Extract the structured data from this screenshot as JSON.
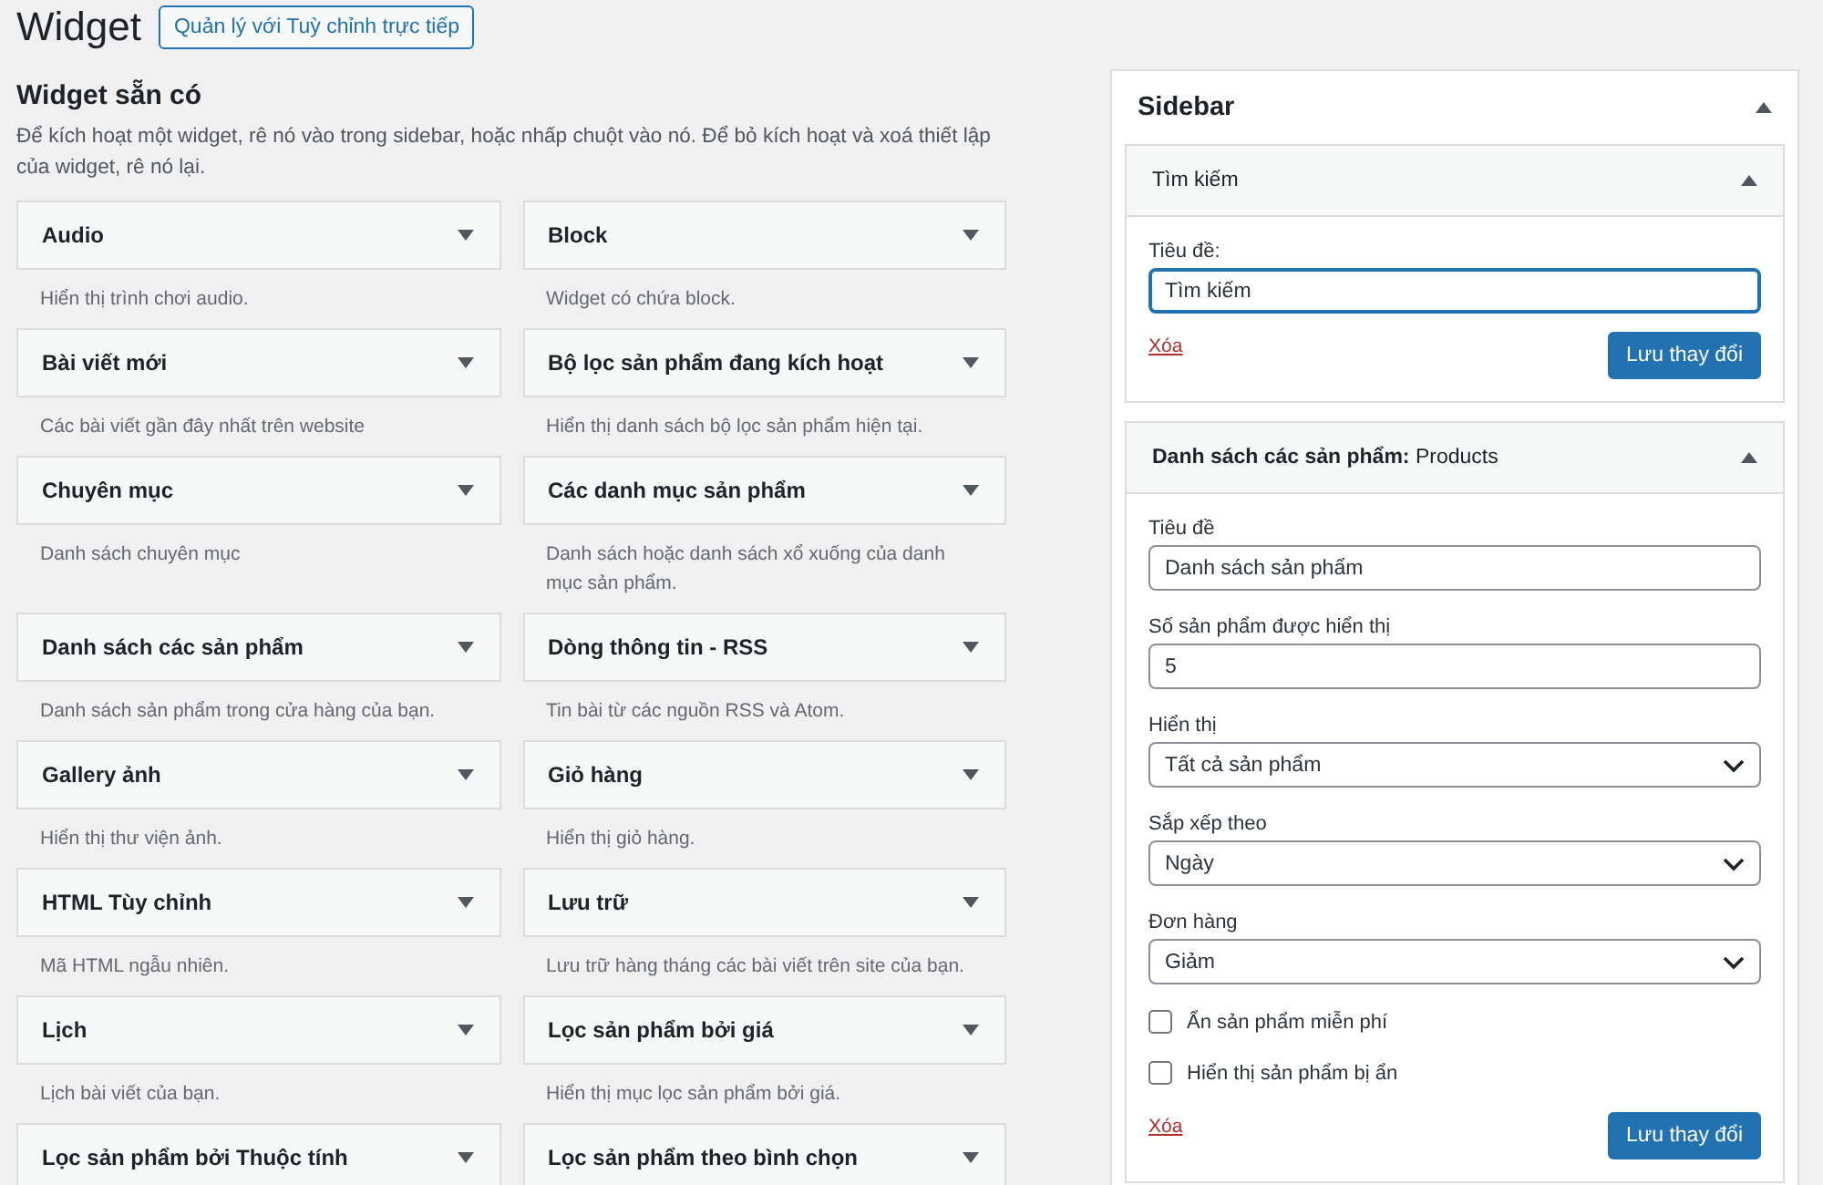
{
  "page": {
    "title": "Widget",
    "action_button": "Quản lý với Tuỳ chỉnh trực tiếp"
  },
  "available": {
    "heading": "Widget sẵn có",
    "description": "Để kích hoạt một widget, rê nó vào trong sidebar, hoặc nhấp chuột vào nó. Để bỏ kích hoạt và xoá thiết lập của widget, rê nó lại.",
    "widgets": [
      {
        "name": "Audio",
        "description": "Hiển thị trình chơi audio."
      },
      {
        "name": "Block",
        "description": "Widget có chứa block."
      },
      {
        "name": "Bài viết mới",
        "description": "Các bài viết gần đây nhất trên website"
      },
      {
        "name": "Bộ lọc sản phẩm đang kích hoạt",
        "description": "Hiển thị danh sách bộ lọc sản phẩm hiện tại."
      },
      {
        "name": "Chuyên mục",
        "description": "Danh sách chuyên mục"
      },
      {
        "name": "Các danh mục sản phẩm",
        "description": "Danh sách hoặc danh sách xổ xuống của danh mục sản phẩm."
      },
      {
        "name": "Danh sách các sản phẩm",
        "description": "Danh sách sản phẩm trong cửa hàng của bạn."
      },
      {
        "name": "Dòng thông tin - RSS",
        "description": "Tin bài từ các nguồn RSS và Atom."
      },
      {
        "name": "Gallery ảnh",
        "description": "Hiển thị thư viện ảnh."
      },
      {
        "name": "Giỏ hàng",
        "description": "Hiển thị giỏ hàng."
      },
      {
        "name": "HTML Tùy chỉnh",
        "description": "Mã HTML ngẫu nhiên."
      },
      {
        "name": "Lưu trữ",
        "description": "Lưu trữ hàng tháng các bài viết trên site của bạn."
      },
      {
        "name": "Lịch",
        "description": "Lịch bài viết của bạn."
      },
      {
        "name": "Lọc sản phẩm bởi giá",
        "description": "Hiển thị mục lọc sản phẩm bởi giá."
      },
      {
        "name": "Lọc sản phẩm bởi Thuộc tính"
      },
      {
        "name": "Lọc sản phẩm theo bình chọn"
      }
    ]
  },
  "sidebar": {
    "title": "Sidebar",
    "expanded": true,
    "widgets": [
      {
        "title": "Tìm kiếm",
        "expanded": true,
        "fields": [
          {
            "kind": "text",
            "label": "Tiêu đề:",
            "value": "Tìm kiếm",
            "focused": true
          }
        ],
        "delete_link": "Xóa",
        "save_button": "Lưu thay đổi"
      },
      {
        "title": "**Danh sách các sản phẩm:** Products",
        "expanded": true,
        "fields": [
          {
            "kind": "text",
            "label": "Tiêu đề",
            "value": "Danh sách sản phẩm",
            "focused": false
          },
          {
            "kind": "text",
            "label": "Số sản phẩm được hiển thị",
            "value": "5",
            "focused": false
          },
          {
            "kind": "select",
            "label": "Hiển thị",
            "value": "Tất cả sản phẩm"
          },
          {
            "kind": "select",
            "label": "Sắp xếp theo",
            "value": "Ngày"
          },
          {
            "kind": "select",
            "label": "Đơn hàng",
            "value": "Giảm"
          },
          {
            "kind": "checkbox",
            "label": "Ẩn sản phẩm miễn phí",
            "checked": false
          },
          {
            "kind": "checkbox",
            "label": "Hiển thị sản phẩm bị ẩn",
            "checked": false
          }
        ],
        "delete_link": "Xóa",
        "save_button": "Lưu thay đổi"
      }
    ]
  }
}
